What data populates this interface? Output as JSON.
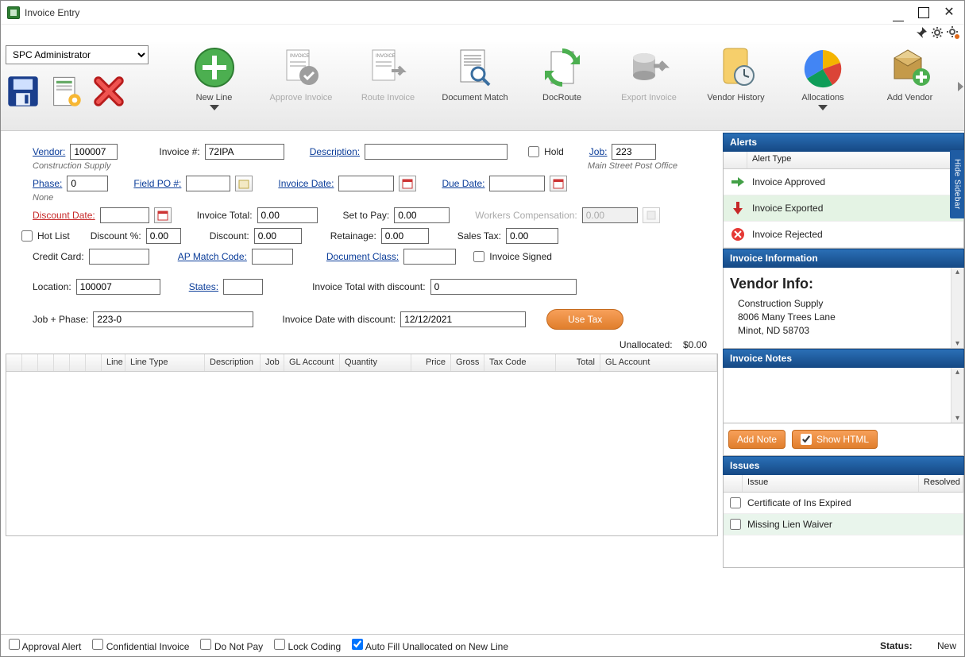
{
  "window": {
    "title": "Invoice Entry"
  },
  "toolbar": {
    "user_selected": "SPC Administrator",
    "new_line": "New Line",
    "approve": "Approve Invoice",
    "route": "Route Invoice",
    "doc_match": "Document Match",
    "doc_route": "DocRoute",
    "export": "Export Invoice",
    "vendor_history": "Vendor History",
    "allocations": "Allocations",
    "add_vendor": "Add Vendor"
  },
  "form": {
    "vendor_label": "Vendor:",
    "vendor": "100007",
    "vendor_desc": "Construction Supply",
    "invoice_num_label": "Invoice #:",
    "invoice_num": "72IPA",
    "description_label": "Description:",
    "description": "",
    "hold_label": "Hold",
    "job_label": "Job:",
    "job": "223",
    "job_desc": "Main Street Post Office",
    "phase_label": "Phase:",
    "phase": "0",
    "phase_desc": "None",
    "field_po_label": "Field PO #:",
    "field_po": "",
    "invoice_date_label": "Invoice Date:",
    "invoice_date": "",
    "due_date_label": "Due Date:",
    "due_date": "",
    "discount_date_label": "Discount Date:",
    "discount_date": "",
    "invoice_total_label": "Invoice Total:",
    "invoice_total": "0.00",
    "set_to_pay_label": "Set to Pay:",
    "set_to_pay": "0.00",
    "workers_comp_label": "Workers Compensation:",
    "workers_comp": "0.00",
    "hot_list_label": "Hot List",
    "discount_pct_label": "Discount %:",
    "discount_pct": "0.00",
    "discount_label": "Discount:",
    "discount": "0.00",
    "retainage_label": "Retainage:",
    "retainage": "0.00",
    "sales_tax_label": "Sales Tax:",
    "sales_tax": "0.00",
    "credit_card_label": "Credit Card:",
    "credit_card": "",
    "ap_match_label": "AP Match Code:",
    "ap_match": "",
    "doc_class_label": "Document Class:",
    "doc_class": "",
    "invoice_signed_label": "Invoice Signed",
    "location_label": "Location:",
    "location": "100007",
    "states_label": "States:",
    "states": "",
    "total_disc_label": "Invoice Total with discount:",
    "total_disc": "0",
    "job_phase_label": "Job + Phase:",
    "job_phase": "223-0",
    "date_disc_label": "Invoice Date with discount:",
    "date_disc": "12/12/2021",
    "use_tax": "Use Tax",
    "unalloc_label": "Unallocated:",
    "unalloc_value": "$0.00"
  },
  "grid_cols": {
    "line": "Line",
    "line_type": "Line Type",
    "description": "Description",
    "job": "Job",
    "gl_account": "GL Account",
    "quantity": "Quantity",
    "price": "Price",
    "gross": "Gross",
    "tax_code": "Tax Code",
    "total": "Total",
    "gl_account2": "GL Account"
  },
  "sidebar": {
    "alerts_title": "Alerts",
    "alert_type_col": "Alert Type",
    "alerts": {
      "a0": "Invoice Approved",
      "a1": "Invoice Exported",
      "a2": "Invoice Rejected"
    },
    "info_title": "Invoice Information",
    "vendor_info_head": "Vendor Info:",
    "vendor_name": "Construction Supply",
    "vendor_addr1": "8006 Many Trees Lane",
    "vendor_addr2": "Minot, ND 58703",
    "notes_title": "Invoice Notes",
    "add_note": "Add Note",
    "show_html": "Show HTML",
    "issues_title": "Issues",
    "issue_col": "Issue",
    "resolved_col": "Resolved",
    "issues": {
      "i0": "Certificate of Ins Expired",
      "i1": "Missing Lien Waiver"
    },
    "hide": "Hide Sidebar"
  },
  "statusbar": {
    "approval_alert": "Approval Alert",
    "confidential": "Confidential Invoice",
    "do_not_pay": "Do Not Pay",
    "lock_coding": "Lock Coding",
    "auto_fill": "Auto Fill Unallocated on New Line",
    "status_label": "Status:",
    "status_value": "New"
  }
}
